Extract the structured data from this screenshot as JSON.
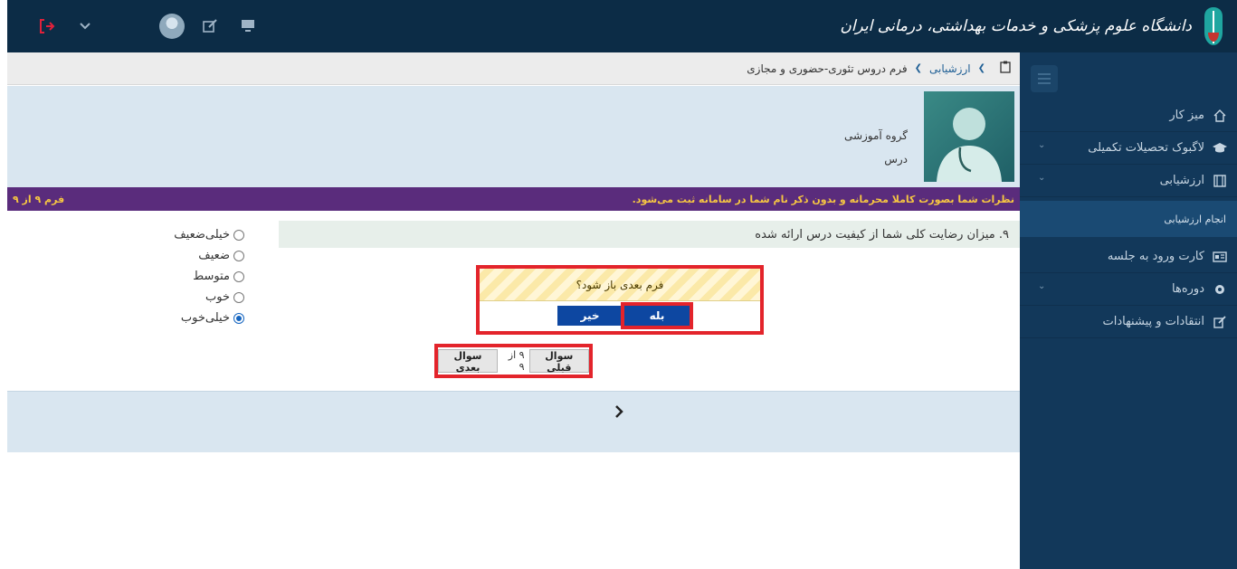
{
  "header": {
    "university_title": "دانشگاه علوم پزشکی و خدمات بهداشتی، درمانی ایران",
    "icons": [
      "exit-icon",
      "chevron-down-icon",
      "user-avatar",
      "edit-icon",
      "monitor-icon"
    ]
  },
  "sidebar": {
    "items": [
      {
        "label": "میز کار",
        "icon": "home-icon"
      },
      {
        "label": "لاگبوک تحصیلات تکمیلی",
        "icon": "graduation-cap-icon"
      },
      {
        "label": "ارزشیابی",
        "icon": "form-icon"
      },
      {
        "label": "کارت ورود به جلسه",
        "icon": "id-card-icon"
      },
      {
        "label": "دوره‌ها",
        "icon": "gear-icon"
      },
      {
        "label": "انتقادات و پیشنهادات",
        "icon": "edit-icon"
      }
    ],
    "sub_item": "انجام ارزشیابی"
  },
  "breadcrumb": {
    "items": [
      "ارزشیابی",
      "فرم دروس تئوری-حضوری و مجازی"
    ]
  },
  "info": {
    "group_label": "گروه آموزشی",
    "course_label": "درس"
  },
  "banner": {
    "notice": "نظرات شما بصورت کاملا محرمانه و بدون ذکر نام شما در سامانه ثبت می‌شود.",
    "form_counter": "فرم ۹ از ۹"
  },
  "question": {
    "text": "۹. میزان رضایت کلی شما از کیفیت درس ارائه شده",
    "options": [
      "خیلی‌ضعیف",
      "ضعیف",
      "متوسط",
      "خوب",
      "خیلی‌خوب"
    ],
    "selected_index": 4
  },
  "dialog": {
    "message": "فرم بعدی باز شود؟",
    "yes_label": "بله",
    "no_label": "خیر"
  },
  "nav": {
    "prev_label": "سوال قبلی",
    "count": "۹ از ۹",
    "next_label": "سوال بعدی"
  },
  "colors": {
    "topbar": "#0c2c46",
    "sidebar": "#12385a",
    "banner": "#5a2c7c",
    "banner_text": "#f5c542",
    "highlight": "#e3242b",
    "button": "#0d47a1"
  }
}
